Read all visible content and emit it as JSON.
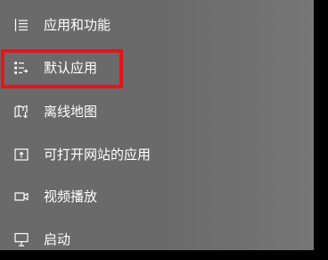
{
  "nav": {
    "items": [
      {
        "label": "应用和功能",
        "icon": "apps-features-icon"
      },
      {
        "label": "默认应用",
        "icon": "default-apps-icon"
      },
      {
        "label": "离线地图",
        "icon": "offline-maps-icon"
      },
      {
        "label": "可打开网站的应用",
        "icon": "apps-for-websites-icon"
      },
      {
        "label": "视频播放",
        "icon": "video-playback-icon"
      },
      {
        "label": "启动",
        "icon": "startup-icon"
      }
    ]
  },
  "colors": {
    "panel_background": "#6a6a6a",
    "text": "#ffffff",
    "highlight": "#e8141b"
  }
}
